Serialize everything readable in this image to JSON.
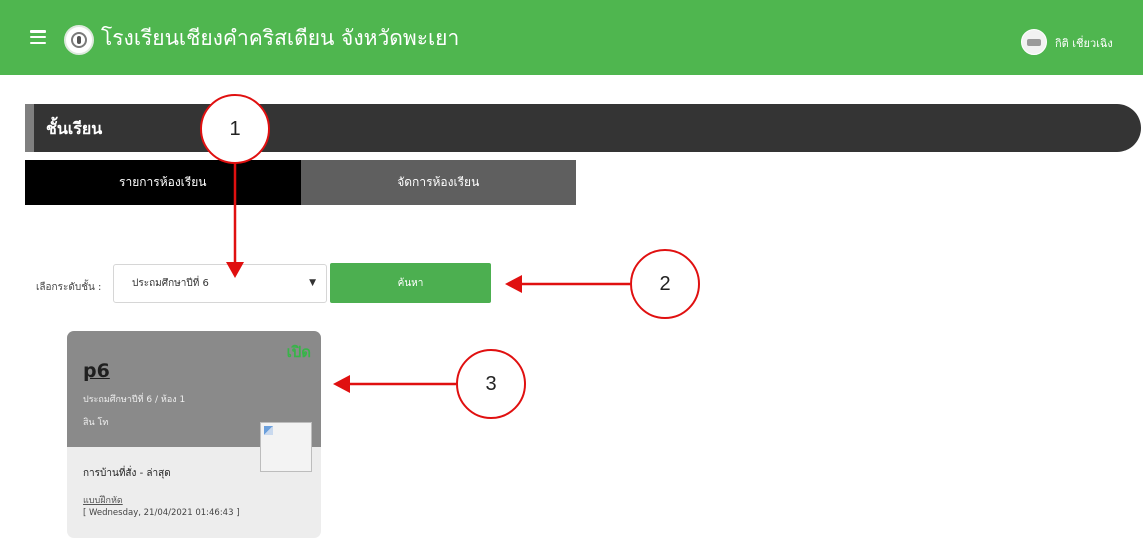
{
  "header": {
    "school_name": "โรงเรียนเชียงคำคริสเตียน จังหวัดพะเยา",
    "user_name": "กิติ เชี่ยวเฉิง",
    "bg_color": "#4fb64f"
  },
  "section": {
    "title": "ชั้นเรียน"
  },
  "tabs": [
    {
      "label": "รายการห้องเรียน",
      "active": true
    },
    {
      "label": "จัดการห้องเรียน",
      "active": false
    }
  ],
  "filter": {
    "label": "เลือกระดับชั้น :",
    "selected": "ประถมศึกษาปีที่ 6",
    "button_label": "ค้นหา",
    "button_color": "#4caf50"
  },
  "card": {
    "status": "เปิด",
    "status_color": "#38b449",
    "name": "p6",
    "grade_room": "ประถมศึกษาปีที่ 6 / ห้อง 1",
    "teacher": "สิน โท",
    "homework_title": "การบ้านที่สั่ง - ล่าสุด",
    "homework_link": "แบบฝึกหัด",
    "homework_date": "[ Wednesday, 21/04/2021 01:46:43 ]"
  },
  "annotations": {
    "callout_1": "1",
    "callout_2": "2",
    "callout_3": "3",
    "color": "#e01010"
  }
}
